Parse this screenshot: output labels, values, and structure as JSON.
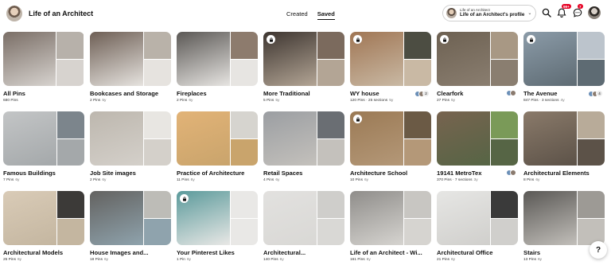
{
  "profile": {
    "name": "Life of an Architect"
  },
  "tabs": [
    {
      "label": "Created",
      "active": false
    },
    {
      "label": "Saved",
      "active": true
    }
  ],
  "account": {
    "small": "Life of an Architect",
    "big": "Life of an Architect's profile"
  },
  "header_icons": [
    {
      "name": "search-icon"
    },
    {
      "name": "notifications-icon",
      "badge": "99+"
    },
    {
      "name": "messages-icon",
      "badge": "7"
    }
  ],
  "accent": "#e60023",
  "boards": [
    {
      "title": "All Pins",
      "meta": "680 Pins",
      "age": "",
      "secret": false,
      "colors": [
        "#7a6e66",
        "#b7b1aa",
        "#d7d3cf"
      ]
    },
    {
      "title": "Bookcases and Storage",
      "meta": "2 Pins",
      "age": "5y",
      "secret": false,
      "colors": [
        "#6e5f55",
        "#b9b2a9",
        "#e6e3df"
      ]
    },
    {
      "title": "Fireplaces",
      "meta": "2 Pins",
      "age": "6y",
      "secret": false,
      "colors": [
        "#5b5855",
        "#8d7b6d",
        "#e7e5e2"
      ]
    },
    {
      "title": "More Traditional",
      "meta": "5 Pins",
      "age": "5y",
      "secret": true,
      "colors": [
        "#3d3530",
        "#7b6a5d",
        "#b3a595"
      ]
    },
    {
      "title": "WY house",
      "meta": "120 Pins · 25 sections",
      "age": "5y",
      "secret": true,
      "colors": [
        "#a07654",
        "#4c4d42",
        "#c9b9a4"
      ],
      "collab_count": "2"
    },
    {
      "title": "Clearfork",
      "meta": "27 Pins",
      "age": "5y",
      "secret": true,
      "colors": [
        "#6d6152",
        "#a89884",
        "#8a7e70"
      ],
      "collab_count": ""
    },
    {
      "title": "The Avenue",
      "meta": "847 Pins · 3 sections",
      "age": "4y",
      "secret": true,
      "colors": [
        "#8b9ba8",
        "#bcc4cc",
        "#5e6b73"
      ],
      "collab_count": "4"
    },
    {
      "title": "Famous Buildings",
      "meta": "7 Pins",
      "age": "6y",
      "secret": false,
      "colors": [
        "#c3c5c6",
        "#7c858c",
        "#a4a8aa"
      ]
    },
    {
      "title": "Job Site images",
      "meta": "2 Pins",
      "age": "6y",
      "secret": false,
      "colors": [
        "#bdb7ae",
        "#e8e6e2",
        "#d4d0ca"
      ]
    },
    {
      "title": "Practice of Architecture",
      "meta": "11 Pins",
      "age": "6y",
      "secret": false,
      "colors": [
        "#e2b377",
        "#d6d4cf",
        "#c9a46c"
      ]
    },
    {
      "title": "Retail Spaces",
      "meta": "4 Pins",
      "age": "6y",
      "secret": false,
      "colors": [
        "#9b9ea2",
        "#6a6e73",
        "#c4c1bc"
      ]
    },
    {
      "title": "Architecture School",
      "meta": "10 Pins",
      "age": "6y",
      "secret": true,
      "colors": [
        "#9b7a55",
        "#6b5a45",
        "#b49878"
      ]
    },
    {
      "title": "19141 MetroTex",
      "meta": "370 Pins · 7 sections",
      "age": "3y",
      "secret": false,
      "colors": [
        "#77634f",
        "#7a9a58",
        "#566545"
      ],
      "collab_count": ""
    },
    {
      "title": "Architectural Elements",
      "meta": "8 Pins",
      "age": "6y",
      "secret": false,
      "colors": [
        "#8a7a6a",
        "#b8ab99",
        "#5c5248"
      ]
    },
    {
      "title": "Architectural Models",
      "meta": "25 Pins",
      "age": "6y",
      "secret": false,
      "colors": [
        "#d9cbb7",
        "#3c3a38",
        "#c4b6a0"
      ]
    },
    {
      "title": "House Images and...",
      "meta": "18 Pins",
      "age": "6y",
      "secret": false,
      "colors": [
        "#636260",
        "#bdbcb7",
        "#8fa3ad"
      ]
    },
    {
      "title": "Your Pinterest Likes",
      "meta": "1 Pin",
      "age": "6y",
      "secret": true,
      "colors": [
        "#5b9a9b",
        "#e9e8e6",
        "#e9e8e6"
      ]
    },
    {
      "title": "Architectural...",
      "meta": "140 Pins",
      "age": "6y",
      "secret": false,
      "colors": [
        "#e2e1df",
        "#cfcecb",
        "#d9d8d5"
      ]
    },
    {
      "title": "Life of an Architect - Wi...",
      "meta": "161 Pins",
      "age": "6y",
      "secret": false,
      "colors": [
        "#8f8d8a",
        "#c8c6c2",
        "#d6d4d0"
      ]
    },
    {
      "title": "Architectural Office",
      "meta": "21 Pins",
      "age": "6y",
      "secret": false,
      "colors": [
        "#e6e6e4",
        "#3a3a3a",
        "#d0cfcc"
      ]
    },
    {
      "title": "Stairs",
      "meta": "13 Pins",
      "age": "6y",
      "secret": false,
      "colors": [
        "#5a5855",
        "#9d9a95",
        "#c2bfba"
      ]
    }
  ],
  "help_label": "?"
}
